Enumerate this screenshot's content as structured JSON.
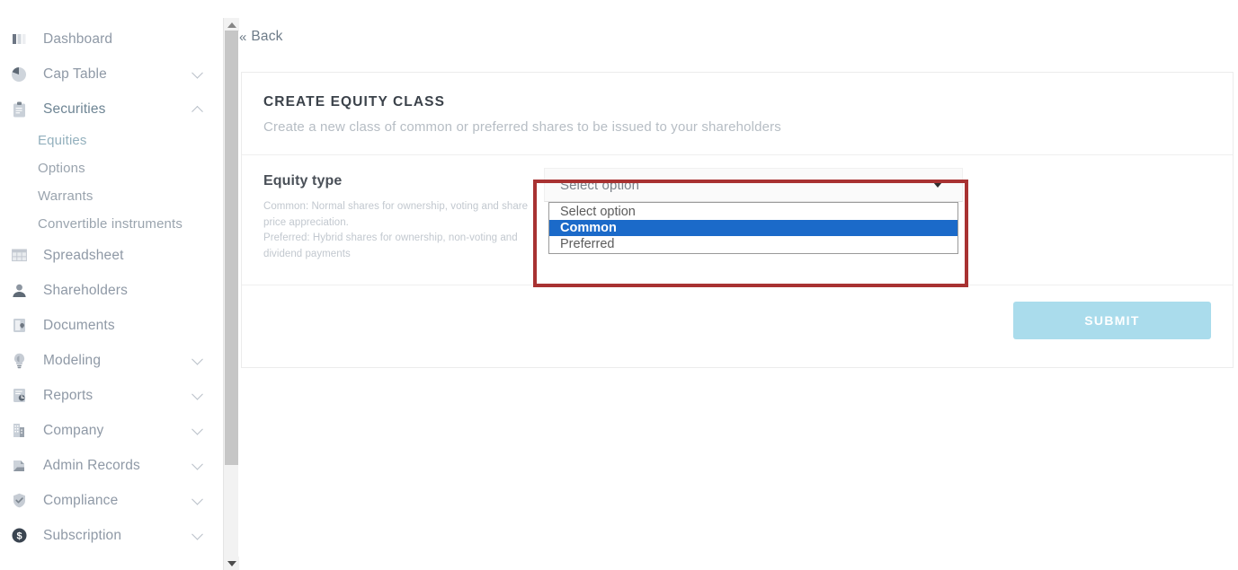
{
  "sidebar": {
    "items": [
      {
        "label": "Dashboard",
        "icon": "bar-chart-icon",
        "expandable": false,
        "expanded": false,
        "active": false
      },
      {
        "label": "Cap Table",
        "icon": "pie-chart-icon",
        "expandable": true,
        "expanded": false,
        "active": false
      },
      {
        "label": "Securities",
        "icon": "clipboard-icon",
        "expandable": true,
        "expanded": true,
        "active": true
      },
      {
        "label": "Spreadsheet",
        "icon": "table-grid-icon",
        "expandable": false,
        "expanded": false,
        "active": false
      },
      {
        "label": "Shareholders",
        "icon": "user-icon",
        "expandable": false,
        "expanded": false,
        "active": false
      },
      {
        "label": "Documents",
        "icon": "document-lock-icon",
        "expandable": false,
        "expanded": false,
        "active": false
      },
      {
        "label": "Modeling",
        "icon": "lightbulb-icon",
        "expandable": true,
        "expanded": false,
        "active": false
      },
      {
        "label": "Reports",
        "icon": "report-icon",
        "expandable": true,
        "expanded": false,
        "active": false
      },
      {
        "label": "Company",
        "icon": "building-icon",
        "expandable": true,
        "expanded": false,
        "active": false
      },
      {
        "label": "Admin Records",
        "icon": "archive-icon",
        "expandable": true,
        "expanded": false,
        "active": false
      },
      {
        "label": "Compliance",
        "icon": "shield-check-icon",
        "expandable": true,
        "expanded": false,
        "active": false
      },
      {
        "label": "Subscription",
        "icon": "dollar-circle-icon",
        "expandable": true,
        "expanded": false,
        "active": false
      }
    ],
    "securities_children": [
      {
        "label": "Equities",
        "active": true
      },
      {
        "label": "Options",
        "active": false
      },
      {
        "label": "Warrants",
        "active": false
      },
      {
        "label": "Convertible instruments",
        "active": false
      }
    ]
  },
  "back": {
    "label": "Back",
    "chevrons": "«"
  },
  "card": {
    "title": "CREATE EQUITY CLASS",
    "subtitle": "Create a new class of common or preferred shares to be issued to your shareholders"
  },
  "field": {
    "label": "Equity type",
    "description": "Common: Normal shares for ownership, voting and share price appreciation.\nPreferred: Hybrid shares for ownership, non-voting and dividend payments"
  },
  "select": {
    "value": "Select option",
    "open": true,
    "options": [
      {
        "label": "Select option",
        "selected": false
      },
      {
        "label": "Common",
        "selected": true
      },
      {
        "label": "Preferred",
        "selected": false
      }
    ]
  },
  "footer": {
    "submit_label": "SUBMIT"
  },
  "colors": {
    "highlight_annotation": "#a83232",
    "option_selected_bg": "#1b6ac9",
    "submit_bg": "#aadcec",
    "sidebar_label": "#8f99a6",
    "active_label": "#6e8594"
  }
}
